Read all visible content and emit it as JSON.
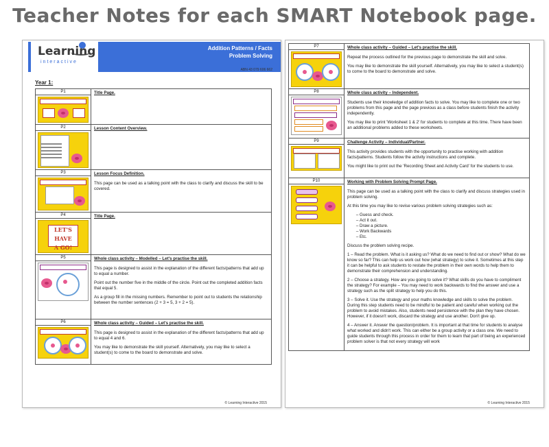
{
  "headline": "Teacher Notes for each SMART Notebook page.",
  "logo": {
    "name": "Learning",
    "sub": "interactive"
  },
  "banner": {
    "title_line1": "Addition Patterns / Facts",
    "title_line2": "Problem Solving",
    "abn": "ABN 43 079 606 662"
  },
  "year_label": "Year 1:",
  "copyright": "© Learning Interactive 2015",
  "left_rows": [
    {
      "page": "P1",
      "heading": "Title Page.",
      "paras": []
    },
    {
      "page": "P2",
      "heading": "Lesson Content Overview.",
      "paras": []
    },
    {
      "page": "P3",
      "heading": "Lesson Focus Definition.",
      "paras": [
        "This page can be used as a talking point with the class to clarify and discuss the skill to be covered."
      ]
    },
    {
      "page": "P4",
      "heading": "Title Page.",
      "paras": [],
      "thumb_text": [
        "LET'S HAVE",
        "A GO!"
      ]
    },
    {
      "page": "P5",
      "heading": "Whole class activity – Modelled – Let's practise the skill.",
      "paras": [
        "This page is designed to assist in the explanation of the different facts/patterns that add up to equal a number.",
        "Point out the number five in the middle of the circle. Point out the completed addition facts that equal 5.",
        "As a group fill in the missing numbers. Remember to point out to students the relationship between the number sentences (2 + 3 = 5, 3 + 2 = 5)."
      ]
    },
    {
      "page": "P6",
      "heading": "Whole class activity – Guided – Let's practise the skill.",
      "paras": [
        "This page is designed to assist in the explanation of the different facts/patterns that add up to equal 4 and 6.",
        "You may like to demonstrate the skill yourself. Alternatively, you may like to select a student(s) to come to the board to demonstrate and solve."
      ]
    }
  ],
  "right_rows": [
    {
      "page": "P7",
      "heading": "Whole class activity – Guided – Let's practise the skill.",
      "paras": [
        "Repeat the process outlined for the previous page to demonstrate the skill and solve.",
        "You may like to demonstrate the skill yourself. Alternatively, you may like to select a student(s) to come to the board to demonstrate and solve."
      ]
    },
    {
      "page": "P8",
      "heading": "Whole class activity – Independent.",
      "paras": [
        "Students use their knowledge of addition facts to solve. You may like to complete one or two problems from this page and the page previous as a class before students finish the activity independently.",
        "You may like to print 'Worksheet 1 & 2' for students to complete at this time. There have been an additional problems added to these worksheets."
      ]
    },
    {
      "page": "P9",
      "heading": "Challenge Activity – Individual/Partner.",
      "paras": [
        "This activity provides students with the opportunity to practise working with addition facts/patterns. Students follow the activity instructions and complete.",
        "You might like to print out the 'Recording Sheet and Activity Card' for the students to use."
      ]
    },
    {
      "page": "P10",
      "heading": "Working with Problem Solving Prompt Page.",
      "paras": [
        "This page can be used as a talking point with the class to clarify and discuss strategies used in problem solving.",
        "At this time you may like to revise various problem solving strategies such as:"
      ],
      "list": [
        "Guess and check.",
        "Act it out.",
        "Draw a picture.",
        "Work Backwards",
        "Etc."
      ],
      "paras2": [
        "Discuss the problem solving recipe.",
        "1 – Read the problem. What is it asking us? What do we need to find out or show? What do we know so far? This can help us work out how (what strategy) to solve it. Sometimes at this step it can be helpful to ask students to restate the problem in their own words to help them to demonstrate their comprehension and understanding.",
        "2 – Choose a strategy. How are you going to solve it? What skills do you have to compliment the strategy? For example – You may need to work backwards to find the answer and use a strategy such as the split strategy to help you do this.",
        "3 – Solve it. Use the strategy and your maths knowledge and skills to solve the problem. During this step students need to be mindful to be patient and careful when working out the problem to avoid mistakes. Also, students need persistence with the plan they have chosen. However, if it doesn't work, discard the strategy and use another. Don't give up.",
        "4 – Answer it. Answer the question/problem. It is important at that time for students to analyse what worked and didn't work. This can either be a group activity or a class one. We need to guide students through this process in order for them to learn that part of being an experienced problem solver is that not every strategy will work"
      ],
      "thumb_labels": [
        "Read the Problem",
        "Choose a Strategy",
        "Solve it",
        "Answer it"
      ]
    }
  ]
}
